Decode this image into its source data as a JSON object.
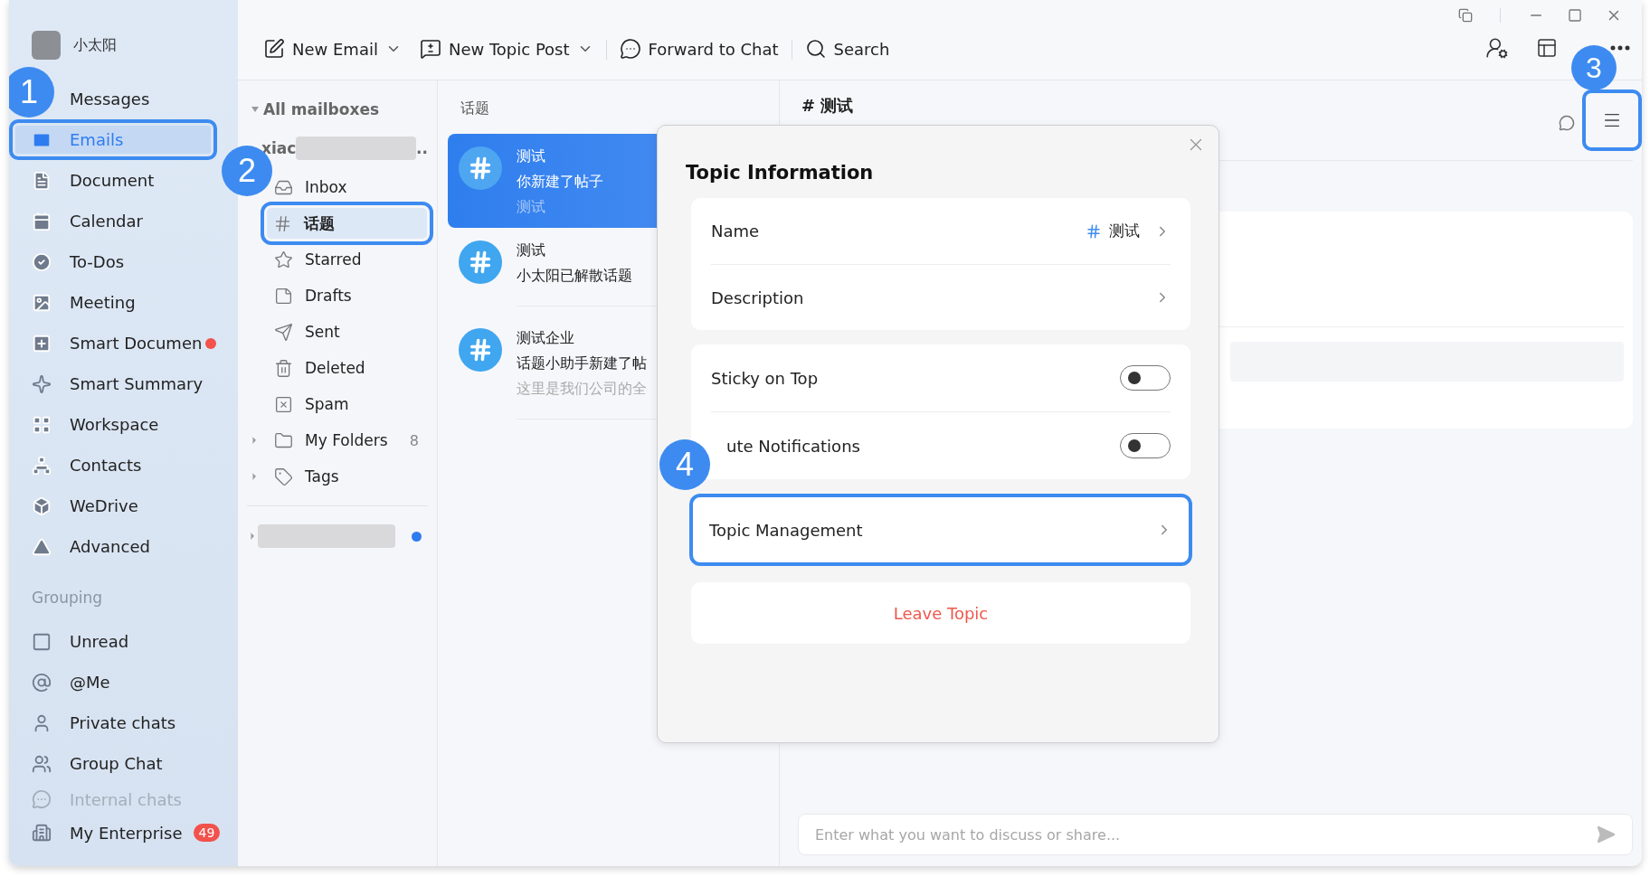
{
  "sidebar": {
    "user": {
      "name": "小太阳"
    },
    "items": [
      {
        "label": "Messages",
        "selected": false,
        "dot": false
      },
      {
        "label": "Emails",
        "selected": true,
        "dot": false,
        "callout": "1"
      },
      {
        "label": "Document",
        "selected": false,
        "dot": false
      },
      {
        "label": "Calendar",
        "selected": false,
        "dot": false
      },
      {
        "label": "To-Dos",
        "selected": false,
        "dot": false
      },
      {
        "label": "Meeting",
        "selected": false,
        "dot": false
      },
      {
        "label": "Smart Documen",
        "selected": false,
        "dot": true
      },
      {
        "label": "Smart Summary",
        "selected": false,
        "dot": false
      },
      {
        "label": "Workspace",
        "selected": false,
        "dot": false
      },
      {
        "label": "Contacts",
        "selected": false,
        "dot": false
      },
      {
        "label": "WeDrive",
        "selected": false,
        "dot": false
      },
      {
        "label": "Advanced",
        "selected": false,
        "dot": false
      }
    ],
    "group_heading": "Grouping",
    "groups": [
      {
        "label": "Unread"
      },
      {
        "label": "@Me"
      },
      {
        "label": "Private chats"
      },
      {
        "label": "Group Chat"
      },
      {
        "label": "Internal chats"
      }
    ],
    "footer": {
      "label": "My Enterprise",
      "badge": "49"
    }
  },
  "toolbar": {
    "actions": [
      {
        "label": "New Email",
        "dropdown": true
      },
      {
        "label": "New Topic Post",
        "dropdown": true
      },
      {
        "label": "Forward to Chat",
        "dropdown": false
      },
      {
        "label": "Search",
        "dropdown": false
      }
    ]
  },
  "mailboxes": {
    "heading": "All mailboxes",
    "account": {
      "prefix": "xiac",
      "suffix": ".."
    },
    "folders": [
      {
        "label": "Inbox",
        "selected": false,
        "expandable": false
      },
      {
        "label": "话题",
        "selected": true,
        "expandable": false,
        "callout": "2"
      },
      {
        "label": "Starred",
        "selected": false,
        "expandable": false
      },
      {
        "label": "Drafts",
        "selected": false,
        "expandable": false
      },
      {
        "label": "Sent",
        "selected": false,
        "expandable": false
      },
      {
        "label": "Deleted",
        "selected": false,
        "expandable": false
      },
      {
        "label": "Spam",
        "selected": false,
        "expandable": false
      },
      {
        "label": "My Folders",
        "selected": false,
        "expandable": true,
        "count": "8"
      },
      {
        "label": "Tags",
        "selected": false,
        "expandable": true
      }
    ]
  },
  "topic_list": {
    "heading": "话题",
    "topics": [
      {
        "title": "测试",
        "preview": "你新建了帖子",
        "extra": "测试",
        "selected": true
      },
      {
        "title": "测试",
        "preview": "小太阳已解散话题",
        "selected": false
      },
      {
        "title": "测试企业",
        "preview": "话题小助手新建了帖",
        "extra": "这里是我们公司的全",
        "selected": false
      }
    ]
  },
  "conversation": {
    "title": "# 测试",
    "menu_button": {
      "callout": "3"
    },
    "composer": {
      "placeholder": "Enter what you want to discuss or share..."
    }
  },
  "modal": {
    "title": "Topic Information",
    "info_rows": [
      {
        "label": "Name",
        "value": "测试"
      },
      {
        "label": "Description"
      }
    ],
    "toggles": [
      {
        "label": "Sticky on Top",
        "on": false
      },
      {
        "label": "ute Notifications",
        "on": false
      }
    ],
    "management": {
      "label": "Topic Management",
      "callout": "4"
    },
    "leave_button": "Leave Topic"
  }
}
